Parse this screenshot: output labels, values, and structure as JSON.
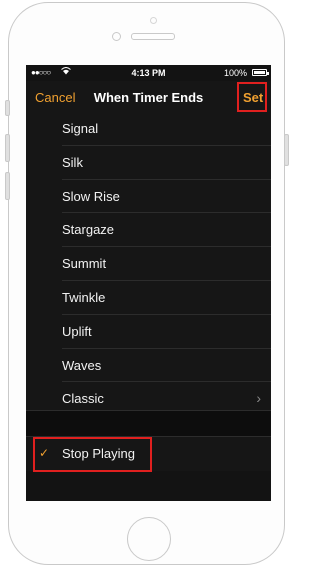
{
  "status_bar": {
    "carrier": "●●○○○",
    "wifi": "wifi-icon",
    "time": "4:13 PM",
    "battery": "100%"
  },
  "nav": {
    "cancel_label": "Cancel",
    "title": "When Timer Ends",
    "set_label": "Set"
  },
  "tones": [
    {
      "label": "Signal"
    },
    {
      "label": "Silk"
    },
    {
      "label": "Slow Rise"
    },
    {
      "label": "Stargaze"
    },
    {
      "label": "Summit"
    },
    {
      "label": "Twinkle"
    },
    {
      "label": "Uplift"
    },
    {
      "label": "Waves"
    },
    {
      "label": "Classic",
      "chevron": "›"
    }
  ],
  "stop_playing": {
    "label": "Stop Playing",
    "checkmark": "✓",
    "selected": true
  },
  "colors": {
    "accent": "#f0a030",
    "highlight": "#e0201f",
    "background": "#131313"
  }
}
